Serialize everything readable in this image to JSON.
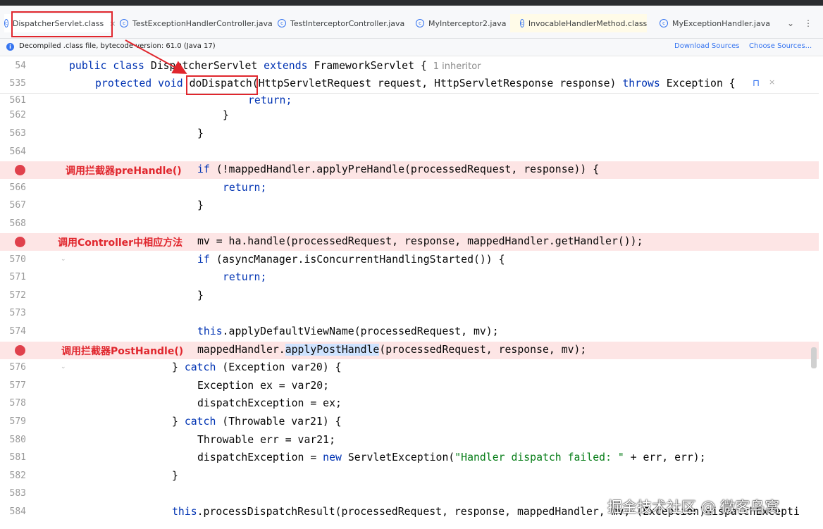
{
  "tabs": [
    {
      "label": "DispatcherServlet.class",
      "close": "×"
    },
    {
      "label": "TestExceptionHandlerController.java"
    },
    {
      "label": "TestInterceptorController.java"
    },
    {
      "label": "MyInterceptor2.java"
    },
    {
      "label": "InvocableHandlerMethod.class"
    },
    {
      "label": "MyExceptionHandler.java"
    }
  ],
  "tabs_more": "⌄",
  "tabs_menu": "⋮",
  "infobar": {
    "text": "Decompiled .class file, bytecode version: 61.0 (Java 17)",
    "download": "Download Sources",
    "choose": "Choose Sources..."
  },
  "sticky": {
    "l1": {
      "num": "54",
      "a": "public class ",
      "b": "DispatcherServlet ",
      "c": "extends ",
      "d": "FrameworkServlet { ",
      "e": "1 inheritor"
    },
    "l2": {
      "num": "535",
      "a": "protected void ",
      "b": "doDispatch",
      "c": "(HttpServletRequest request, HttpServletResponse response) ",
      "d": "throws ",
      "e": "Exception {"
    }
  },
  "lines": {
    "l561": {
      "num": "561",
      "a": "return;"
    },
    "l562": {
      "num": "562",
      "a": "}"
    },
    "l563": {
      "num": "563",
      "a": "}"
    },
    "l564": {
      "num": "564"
    },
    "l565": {
      "a": "if ",
      "b": "(!mappedHandler.applyPreHandle(processedRequest, response)) {"
    },
    "l566": {
      "num": "566",
      "a": "return;"
    },
    "l567": {
      "num": "567",
      "a": "}"
    },
    "l568": {
      "num": "568"
    },
    "l569": {
      "a": "mv = ha.handle(processedRequest, response, mappedHandler.getHandler());"
    },
    "l570": {
      "num": "570",
      "a": "if ",
      "b": "(asyncManager.isConcurrentHandlingStarted()) {"
    },
    "l571": {
      "num": "571",
      "a": "return;"
    },
    "l572": {
      "num": "572",
      "a": "}"
    },
    "l573": {
      "num": "573"
    },
    "l574": {
      "num": "574",
      "a": "this",
      "b": ".applyDefaultViewName(processedRequest, mv);"
    },
    "l575": {
      "a": "mappedHandler.",
      "b": "applyPostHandle",
      "c": "(processedRequest, response, mv);"
    },
    "l576": {
      "num": "576",
      "a": "} ",
      "b": "catch ",
      "c": "(Exception var20) {"
    },
    "l577": {
      "num": "577",
      "a": "Exception ex = var20;"
    },
    "l578": {
      "num": "578",
      "a": "dispatchException = ex;"
    },
    "l579": {
      "num": "579",
      "a": "} ",
      "b": "catch ",
      "c": "(Throwable var21) {"
    },
    "l580": {
      "num": "580",
      "a": "Throwable err = var21;"
    },
    "l581": {
      "num": "581",
      "a": "dispatchException = ",
      "b": "new ",
      "c": "ServletException(",
      "d": "\"Handler dispatch failed: \"",
      "e": " + err, err);"
    },
    "l582": {
      "num": "582",
      "a": "}"
    },
    "l583": {
      "num": "583"
    },
    "l584": {
      "num": "584",
      "a": "this",
      "b": ".processDispatchResult(processedRequest, response, mappedHandler, mv, (Exception)dispatchExcepti"
    }
  },
  "annotations": {
    "pre": "调用拦截器preHandle()",
    "ctrl": "调用Controller中相应方法",
    "post": "调用拦截器PostHandle()"
  },
  "reader_mode_icon": "⊓",
  "reader_close": "×",
  "watermark": "掘金技术社区 @ 微客鸟窝",
  "colors": {
    "keyword": "#0033b3",
    "string": "#067d17",
    "highlight": "#fde5e5",
    "breakpoint": "#e0414c",
    "annotation": "#e0262d",
    "link": "#3574f0"
  }
}
